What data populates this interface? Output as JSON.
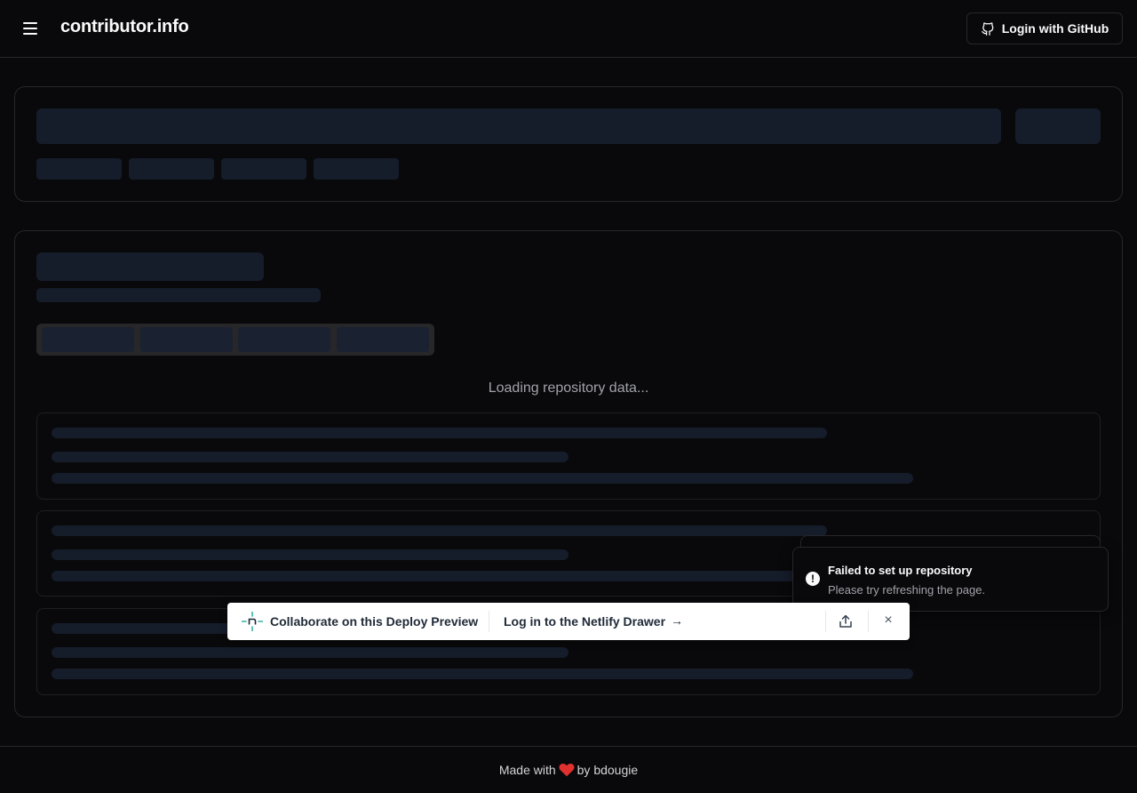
{
  "header": {
    "brand": "contributor.info",
    "login_label": "Login with GitHub"
  },
  "main": {
    "loading_text": "Loading repository data..."
  },
  "toast": {
    "title": "Failed to set up repository",
    "description": "Please try refreshing the page."
  },
  "netlify": {
    "collab_label": "Collaborate on this Deploy Preview",
    "login_label": "Log in to the Netlify Drawer",
    "arrow": "→",
    "close": "×"
  },
  "footer": {
    "made_with": "Made with",
    "by": "by bdougie"
  },
  "colors": {
    "background": "#09090b",
    "border": "#27272a",
    "skeleton": "#151c2a",
    "netlify_accent": "#32b4a8"
  },
  "icons": {
    "menu": "menu-icon",
    "github": "github-icon",
    "alert": "alert-circle-icon",
    "netlify": "netlify-logo-icon",
    "share": "share-icon",
    "close": "close-icon",
    "heart": "heart-icon"
  }
}
